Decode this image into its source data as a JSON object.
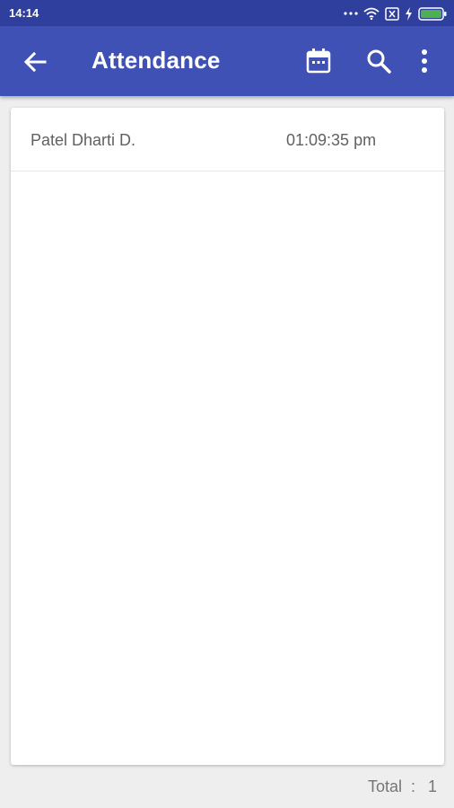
{
  "status_bar": {
    "time": "14:14",
    "icons": [
      "dots-icon",
      "wifi-icon",
      "sim-x-icon",
      "charging-icon",
      "battery-icon"
    ],
    "battery_color": "#4caf50"
  },
  "app_bar": {
    "title": "Attendance",
    "background": "#3f51b5",
    "actions": [
      "back-arrow-icon",
      "calendar-icon",
      "search-icon",
      "more-vert-icon"
    ]
  },
  "attendance_list": [
    {
      "name": "Patel Dharti D.",
      "time": "01:09:35 pm"
    }
  ],
  "footer": {
    "total_label": "Total",
    "separator": ":",
    "total_value": "1"
  }
}
